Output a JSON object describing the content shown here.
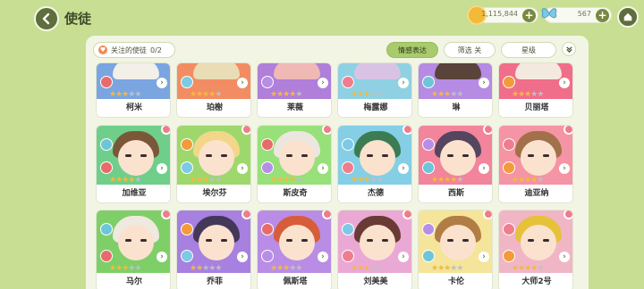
{
  "header": {
    "title": "使徒",
    "gold": "1,115,844",
    "gems": "567"
  },
  "toolbar": {
    "favorites_label": "关注的使徒",
    "favorites_count": "0/2",
    "emotion_label": "情感表达",
    "filter_label": "筛选 关",
    "star_label": "星级"
  },
  "rows": [
    {
      "cards": [
        {
          "name": "柯米",
          "bg": "#7ba5e0",
          "hair": "#f3efe9",
          "stars": 3
        },
        {
          "name": "珀榭",
          "bg": "#f28d63",
          "hair": "#eadcb5",
          "stars": 4
        },
        {
          "name": "莱薇",
          "bg": "#b07fd9",
          "hair": "#f0b9b5",
          "stars": 4
        },
        {
          "name": "梅露娜",
          "bg": "#8fd1e3",
          "hair": "#d8c3e5",
          "stars": 3
        },
        {
          "name": "琳",
          "bg": "#b58be3",
          "hair": "#59433b",
          "stars": 3
        },
        {
          "name": "贝丽塔",
          "bg": "#f06e8a",
          "hair": "#f4e9df",
          "stars": 3
        }
      ]
    },
    {
      "cards": [
        {
          "name": "加维亚",
          "bg": "#6fcf8a",
          "hair": "#7a5739",
          "stars": 4
        },
        {
          "name": "埃尔芬",
          "bg": "#9ed86c",
          "hair": "#f2d78a",
          "stars": 3
        },
        {
          "name": "斯皮奇",
          "bg": "#98e07a",
          "hair": "#ece7de",
          "stars": 4
        },
        {
          "name": "杰德",
          "bg": "#84cfe6",
          "hair": "#3c7c52",
          "stars": 3
        },
        {
          "name": "西斯",
          "bg": "#f2849b",
          "hair": "#55455e",
          "stars": 4
        },
        {
          "name": "迪亚纳",
          "bg": "#f594a4",
          "hair": "#a2704a",
          "stars": 4
        }
      ]
    },
    {
      "cards": [
        {
          "name": "马尔",
          "bg": "#7ecf68",
          "hair": "#efe9df",
          "stars": 3
        },
        {
          "name": "乔菲",
          "bg": "#a780e0",
          "hair": "#44385a",
          "stars": 2
        },
        {
          "name": "佩斯塔",
          "bg": "#b98de5",
          "hair": "#d75d3a",
          "stars": 3
        },
        {
          "name": "刘美美",
          "bg": "#eaa9d5",
          "hair": "#6a3a34",
          "stars": 3
        },
        {
          "name": "卡伦",
          "bg": "#f4e59a",
          "hair": "#b17d45",
          "stars": 3
        },
        {
          "name": "大师2号",
          "bg": "#f0b6c6",
          "hair": "#e6c23a",
          "stars": 4
        }
      ]
    }
  ]
}
